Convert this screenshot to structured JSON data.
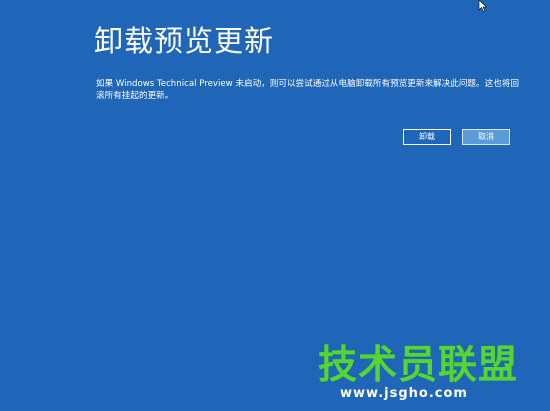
{
  "dialog": {
    "title": "卸载预览更新",
    "description": "如果 Windows Technical Preview 未启动，则可以尝试通过从电脑卸载所有预览更新来解决此问题。这也将回滚所有挂起的更新。",
    "buttons": {
      "uninstall_label": "卸载",
      "cancel_label": "取消"
    }
  },
  "watermark": {
    "site_name": "技术员联盟",
    "url": "www.jsgho.com"
  },
  "theme": {
    "background": "#1f65b8",
    "text": "#ffffff",
    "cancel_button": "#5b9bd8",
    "watermark_green": "#55d62e"
  },
  "icons": {
    "cursor": "mouse-pointer-icon"
  }
}
